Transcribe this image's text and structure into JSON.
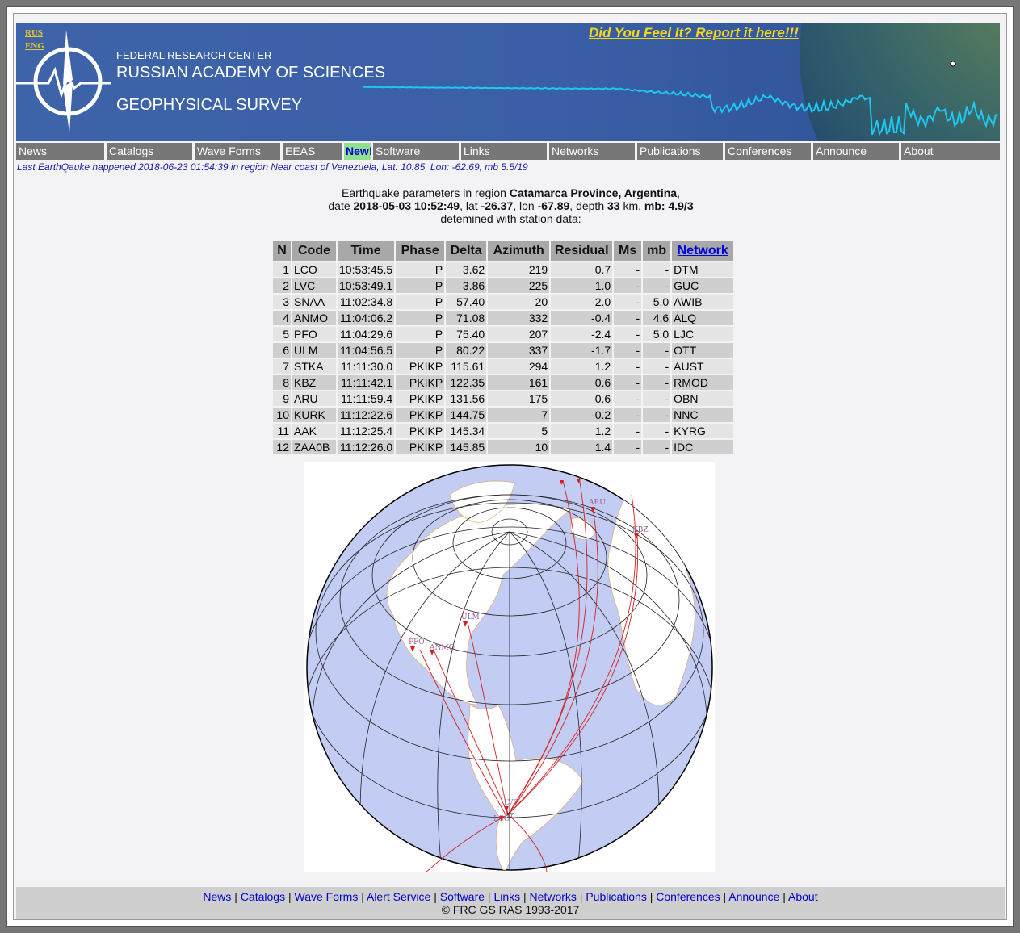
{
  "header": {
    "lang_rus": "RUS",
    "lang_eng": "ENG",
    "org_line1": "FEDERAL RESEARCH CENTER",
    "org_line2": "RUSSIAN ACADEMY OF SCIENCES",
    "org_line3": "GEOPHYSICAL SURVEY",
    "felt_link": "Did You Feel It? Report it here!!!"
  },
  "menu": [
    {
      "label": "News",
      "width": 109
    },
    {
      "label": "Catalogs",
      "width": 109
    },
    {
      "label": "Wave Forms",
      "width": 109
    },
    {
      "label": "EEAS",
      "width": 76
    },
    {
      "label": "New!",
      "new": true,
      "width": 36
    },
    {
      "label": "Software",
      "width": 109
    },
    {
      "label": "Links",
      "width": 109
    },
    {
      "label": "Networks",
      "width": 109
    },
    {
      "label": "Publications",
      "width": 109
    },
    {
      "label": "Conferences",
      "width": 109
    },
    {
      "label": "Announce",
      "width": 109
    },
    {
      "label": "About",
      "width": 105
    }
  ],
  "last_quake": "Last EarthQauke happened 2018-06-23 01:54:39 in region Near coast of Venezuela, Lat: 10.85, Lon: -62.69, mb 5.5/19",
  "params": {
    "line1_prefix": "Earthquake parameters in region ",
    "region": "Catamarca Province, Argentina",
    "line1_suffix": ",",
    "date_label": "date ",
    "date": "2018-05-03 10:52:49",
    "lat_label": ", lat ",
    "lat": "-26.37",
    "lon_label": ", lon ",
    "lon": "-67.89",
    "depth_label": ", depth ",
    "depth": "33",
    "km_label": " km, ",
    "mb_label": "mb: 4.9/3",
    "line3": "detemined with station data:"
  },
  "table": {
    "headers": [
      "N",
      "Code",
      "Time",
      "Phase",
      "Delta",
      "Azimuth",
      "Residual",
      "Ms",
      "mb",
      "Network"
    ],
    "rows": [
      [
        "1",
        "LCO",
        "10:53:45.5",
        "P",
        "3.62",
        "219",
        "0.7",
        "-",
        "-",
        "DTM"
      ],
      [
        "2",
        "LVC",
        "10:53:49.1",
        "P",
        "3.86",
        "225",
        "1.0",
        "-",
        "-",
        "GUC"
      ],
      [
        "3",
        "SNAA",
        "11:02:34.8",
        "P",
        "57.40",
        "20",
        "-2.0",
        "-",
        "5.0",
        "AWIB"
      ],
      [
        "4",
        "ANMO",
        "11:04:06.2",
        "P",
        "71.08",
        "332",
        "-0.4",
        "-",
        "4.6",
        "ALQ"
      ],
      [
        "5",
        "PFO",
        "11:04:29.6",
        "P",
        "75.40",
        "207",
        "-2.4",
        "-",
        "5.0",
        "LJC"
      ],
      [
        "6",
        "ULM",
        "11:04:56.5",
        "P",
        "80.22",
        "337",
        "-1.7",
        "-",
        "-",
        "OTT"
      ],
      [
        "7",
        "STKA",
        "11:11:30.0",
        "PKIKP",
        "115.61",
        "294",
        "1.2",
        "-",
        "-",
        "AUST"
      ],
      [
        "8",
        "KBZ",
        "11:11:42.1",
        "PKIKP",
        "122.35",
        "161",
        "0.6",
        "-",
        "-",
        "RMOD"
      ],
      [
        "9",
        "ARU",
        "11:11:59.4",
        "PKIKP",
        "131.56",
        "175",
        "0.6",
        "-",
        "-",
        "OBN"
      ],
      [
        "10",
        "KURK",
        "11:12:22.6",
        "PKIKP",
        "144.75",
        "7",
        "-0.2",
        "-",
        "-",
        "NNC"
      ],
      [
        "11",
        "AAK",
        "11:12:25.4",
        "PKIKP",
        "145.34",
        "5",
        "1.2",
        "-",
        "-",
        "KYRG"
      ],
      [
        "12",
        "ZAA0B",
        "11:12:26.0",
        "PKIKP",
        "145.85",
        "10",
        "1.4",
        "-",
        "-",
        "IDC"
      ]
    ]
  },
  "map_labels": {
    "aru": "ARU",
    "kbz": "KBZ",
    "ulm": "ULM",
    "pfo": "PFO",
    "anmo": "ANMO",
    "lvc": "LVC",
    "lco": "LCO"
  },
  "footer": {
    "links": [
      "News",
      "Catalogs",
      "Wave Forms",
      "Alert Service",
      "Software",
      "Links",
      "Networks",
      "Publications",
      "Conferences",
      "Announce",
      "About"
    ],
    "separator": " | ",
    "copyright": "© FRC GS RAS 1993-2017"
  },
  "colors": {
    "banner_blue": "#3d63a9",
    "waveform": "#1ec8f0",
    "menu_gray": "#777777",
    "link_blue": "#0000cc",
    "felt_yellow": "#f4d81c",
    "ocean": "#c3ccf3",
    "ray_red": "#d22020"
  }
}
